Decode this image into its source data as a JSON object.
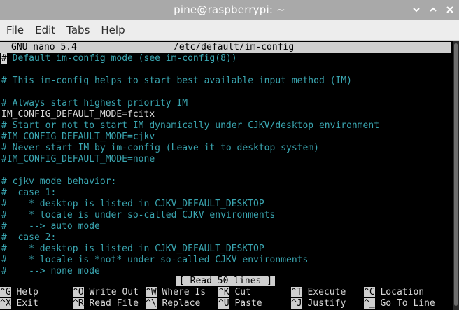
{
  "window": {
    "title": "pine@raspberrypi: ~"
  },
  "menu": [
    "File",
    "Edit",
    "Tabs",
    "Help"
  ],
  "nano": {
    "version": "GNU nano 5.4",
    "filename": "/etc/default/im-config",
    "cursor_char": "#",
    "lines": [
      {
        "text": " Default im-config mode (see im-config(8))",
        "type": "comment",
        "cursor": true
      },
      {
        "text": "",
        "type": "plain"
      },
      {
        "text": "# This im-config helps to start best available input method (IM)",
        "type": "comment"
      },
      {
        "text": "",
        "type": "plain"
      },
      {
        "text": "# Always start highest priority IM",
        "type": "comment"
      },
      {
        "text": "IM_CONFIG_DEFAULT_MODE=fcitx",
        "type": "plain"
      },
      {
        "text": "# Start or not to start IM dynamically under CJKV/desktop environment",
        "type": "comment"
      },
      {
        "text": "#IM_CONFIG_DEFAULT_MODE=cjkv",
        "type": "comment"
      },
      {
        "text": "# Never start IM by im-config (Leave it to desktop system)",
        "type": "comment"
      },
      {
        "text": "#IM_CONFIG_DEFAULT_MODE=none",
        "type": "comment"
      },
      {
        "text": "",
        "type": "plain"
      },
      {
        "text": "# cjkv mode behavior:",
        "type": "comment"
      },
      {
        "text": "#  case 1:",
        "type": "comment"
      },
      {
        "text": "#    * desktop is listed in CJKV_DEFAULT_DESKTOP",
        "type": "comment"
      },
      {
        "text": "#    * locale is under so-called CJKV environments",
        "type": "comment"
      },
      {
        "text": "#    --> auto mode",
        "type": "comment"
      },
      {
        "text": "#  case 2:",
        "type": "comment"
      },
      {
        "text": "#    * desktop is listed in CJKV_DEFAULT_DESKTOP",
        "type": "comment"
      },
      {
        "text": "#    * locale is *not* under so-called CJKV environments",
        "type": "comment"
      },
      {
        "text": "#    --> none mode",
        "type": "comment"
      }
    ],
    "status": "[ Read 50 lines ]",
    "shortcuts": [
      {
        "key": "^G",
        "label": " Help",
        "name": "help"
      },
      {
        "key": "^O",
        "label": " Write Out",
        "name": "write-out"
      },
      {
        "key": "^W",
        "label": " Where Is",
        "name": "where-is"
      },
      {
        "key": "^K",
        "label": " Cut",
        "name": "cut"
      },
      {
        "key": "^T",
        "label": " Execute",
        "name": "execute"
      },
      {
        "key": "^C",
        "label": " Location",
        "name": "location"
      },
      {
        "key": "^X",
        "label": " Exit",
        "name": "exit"
      },
      {
        "key": "^R",
        "label": " Read File",
        "name": "read-file"
      },
      {
        "key": "^\\",
        "label": " Replace",
        "name": "replace"
      },
      {
        "key": "^U",
        "label": " Paste",
        "name": "paste"
      },
      {
        "key": "^J",
        "label": " Justify",
        "name": "justify"
      },
      {
        "key": "^_",
        "label": " Go To Line",
        "name": "go-to-line"
      }
    ]
  },
  "colors": {
    "comment": "#3aa6b1",
    "titlebar": "#a9a9a9",
    "menubar": "#ededed",
    "header_bg": "#cfcfcf"
  }
}
